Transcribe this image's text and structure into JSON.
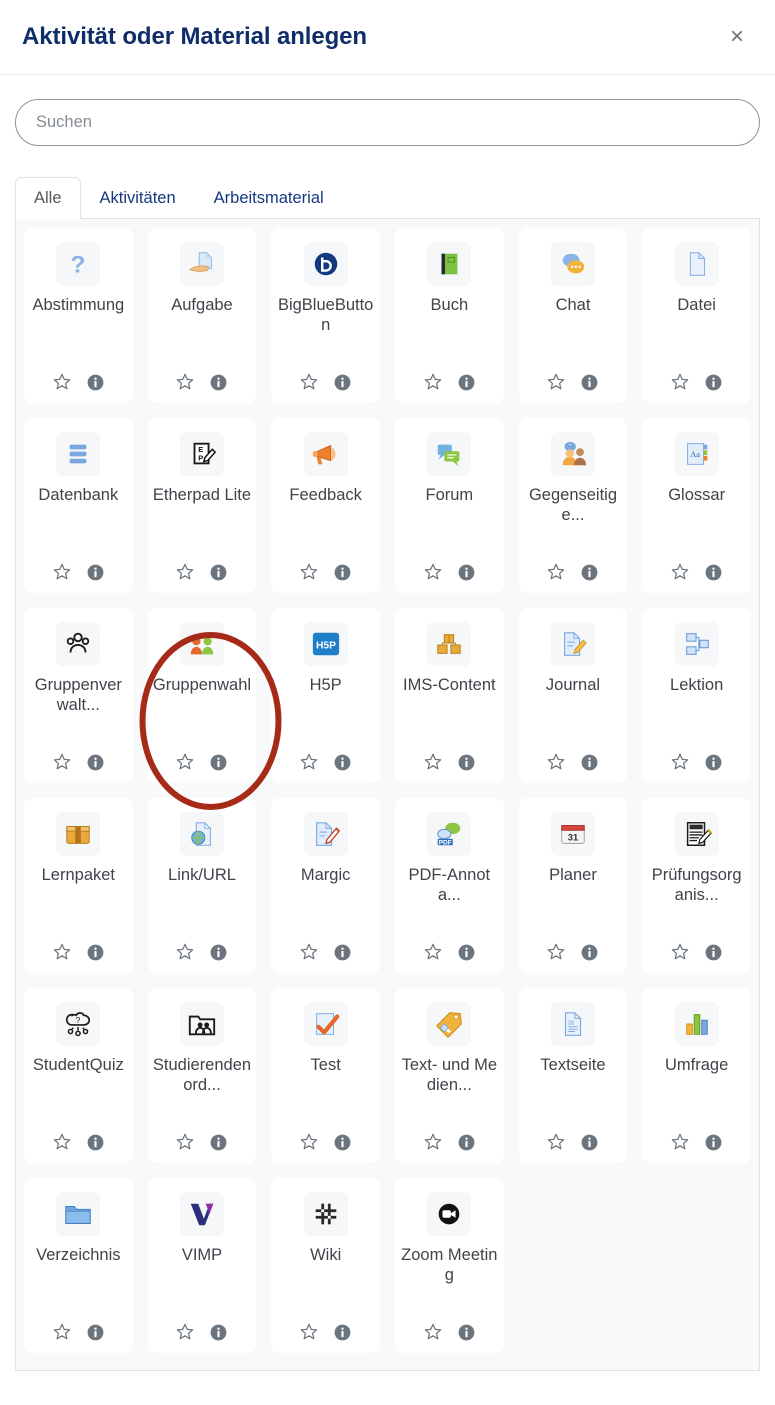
{
  "header": {
    "title": "Aktivität oder Material anlegen",
    "close_label": "×",
    "close_icon": "close-icon"
  },
  "search": {
    "placeholder": "Suchen",
    "value": ""
  },
  "tabs": [
    {
      "label": "Alle",
      "active": true
    },
    {
      "label": "Aktivitäten",
      "active": false
    },
    {
      "label": "Arbeitsmaterial",
      "active": false
    }
  ],
  "card_actions": {
    "favourite_icon": "star-icon",
    "info_icon": "info-icon"
  },
  "annotation": {
    "shape": "ellipse",
    "color": "#a52a18",
    "target_label": "Gruppenwahl"
  },
  "colors": {
    "title": "#0f2d69",
    "tab_link": "#14387f",
    "panel_bg": "#f8f9fa",
    "card_bg": "#ffffff",
    "border": "#dee2e6",
    "label_text": "#3f444a",
    "annotation": "#a52a18"
  },
  "activities": [
    {
      "label": "Abstimmung",
      "icon": "question-mark-icon"
    },
    {
      "label": "Aufgabe",
      "icon": "hand-document-icon"
    },
    {
      "label": "BigBlueButton",
      "icon": "bigbluebutton-icon"
    },
    {
      "label": "Buch",
      "icon": "green-book-icon"
    },
    {
      "label": "Chat",
      "icon": "speech-bubbles-icon"
    },
    {
      "label": "Datei",
      "icon": "file-icon"
    },
    {
      "label": "Datenbank",
      "icon": "database-icon"
    },
    {
      "label": "Etherpad Lite",
      "icon": "etherpad-icon"
    },
    {
      "label": "Feedback",
      "icon": "megaphone-icon"
    },
    {
      "label": "Forum",
      "icon": "forum-icon"
    },
    {
      "label": "Gegenseitige...",
      "icon": "peer-review-icon"
    },
    {
      "label": "Glossar",
      "icon": "glossary-icon"
    },
    {
      "label": "Gruppenverwalt...",
      "icon": "group-management-icon"
    },
    {
      "label": "Gruppenwahl",
      "icon": "group-choice-icon"
    },
    {
      "label": "H5P",
      "icon": "h5p-icon"
    },
    {
      "label": "IMS-Content",
      "icon": "ims-content-icon"
    },
    {
      "label": "Journal",
      "icon": "journal-icon"
    },
    {
      "label": "Lektion",
      "icon": "lesson-icon"
    },
    {
      "label": "Lernpaket",
      "icon": "scorm-package-icon"
    },
    {
      "label": "Link/URL",
      "icon": "url-globe-icon"
    },
    {
      "label": "Margic",
      "icon": "margic-icon"
    },
    {
      "label": "PDF-Annota...",
      "icon": "pdf-annotation-icon"
    },
    {
      "label": "Planer",
      "icon": "calendar-icon"
    },
    {
      "label": "Prüfungsorganis...",
      "icon": "exam-organisation-icon"
    },
    {
      "label": "StudentQuiz",
      "icon": "studentquiz-icon"
    },
    {
      "label": "Studierendenord...",
      "icon": "student-folder-icon"
    },
    {
      "label": "Test",
      "icon": "quiz-check-icon"
    },
    {
      "label": "Text- und Medien...",
      "icon": "label-tag-icon"
    },
    {
      "label": "Textseite",
      "icon": "textpage-icon"
    },
    {
      "label": "Umfrage",
      "icon": "survey-chart-icon"
    },
    {
      "label": "Verzeichnis",
      "icon": "folder-icon"
    },
    {
      "label": "VIMP",
      "icon": "vimp-icon"
    },
    {
      "label": "Wiki",
      "icon": "wiki-icon"
    },
    {
      "label": "Zoom Meeting",
      "icon": "zoom-camera-icon"
    }
  ]
}
